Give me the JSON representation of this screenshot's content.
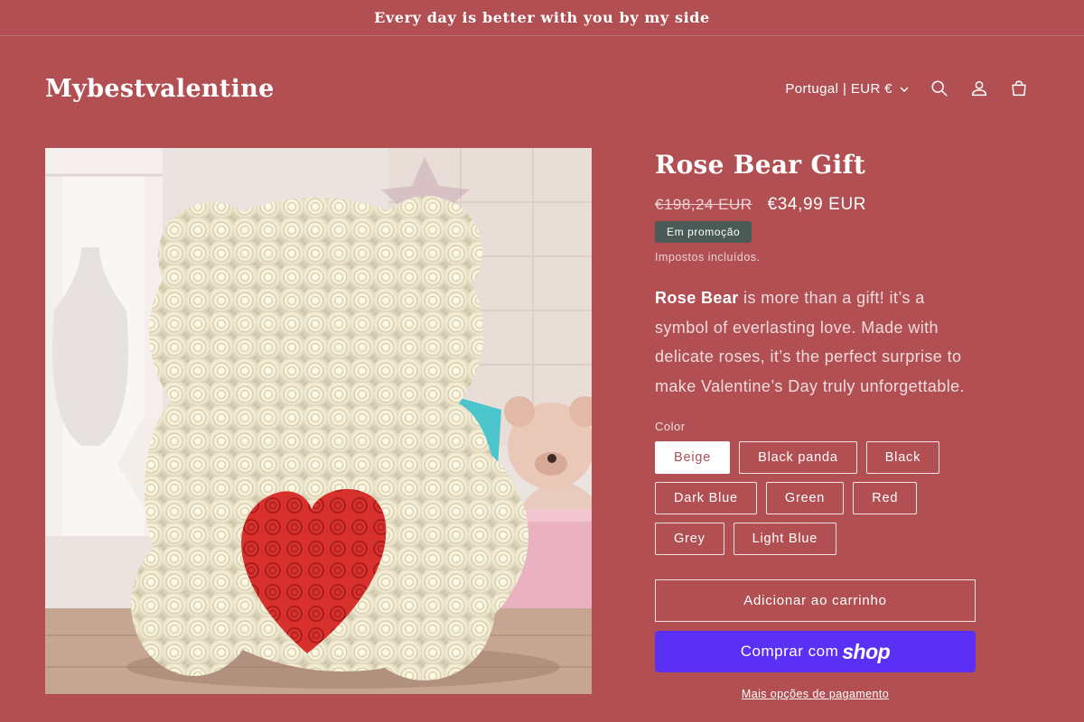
{
  "announcement": {
    "text": "Every day is better with you by my side"
  },
  "header": {
    "logo": "Mybestvalentine",
    "locale": "Portugal | EUR €",
    "icons": [
      "search-icon",
      "account-icon",
      "cart-icon"
    ]
  },
  "product": {
    "image_alt": "Rose Bear",
    "title": "Rose Bear Gift",
    "price_compare": "€198,24 EUR",
    "price_sale": "€34,99 EUR",
    "badge": "Em promoção",
    "tax_note": "Impostos incluídos.",
    "description_strong": "Rose Bear",
    "description_rest": " is more than a gift! it’s a symbol of everlasting love. Made with delicate roses, it’s the perfect surprise to make Valentine’s Day truly unforgettable.",
    "color_label": "Color",
    "colors": [
      "Beige",
      "Black panda",
      "Black",
      "Dark Blue",
      "Green",
      "Red",
      "Grey",
      "Light Blue"
    ],
    "selected_color": "Beige",
    "add_to_cart": "Adicionar ao carrinho",
    "shop_pay_text": "Comprar com",
    "shop_pay_brand": "shop",
    "more_payment": "Mais opções de pagamento"
  },
  "colors": {
    "background": "#b14f53",
    "badge": "#4a5a57",
    "shop_pay": "#5a31f4",
    "text": "#ffffff"
  }
}
